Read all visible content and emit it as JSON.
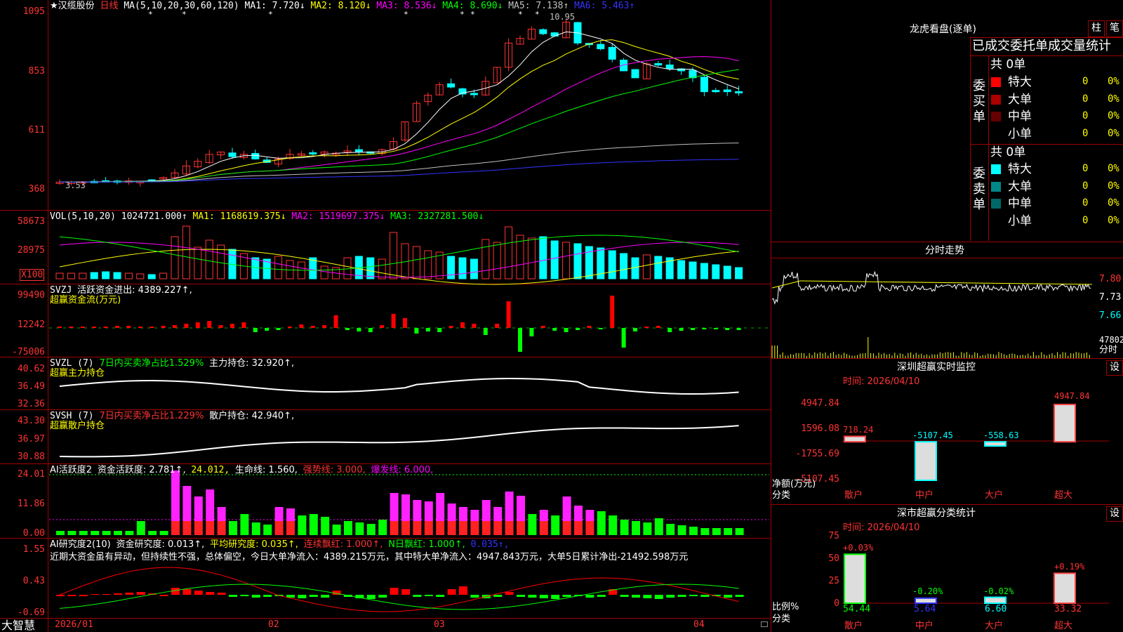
{
  "stock": {
    "star": "★",
    "name": "汉缆股份",
    "period": "日线"
  },
  "ma_header": {
    "params": "MA(5,10,20,30,60,120)",
    "ma1": "MA1: 7.720↓",
    "ma2": "MA2: 8.120↓",
    "ma3": "MA3: 8.536↓",
    "ma4": "MA4: 8.690↓",
    "ma5": "MA5: 7.138↑",
    "ma6": "MA6: 5.463↑",
    "high_mark": "10.95",
    "low_mark": "3.53"
  },
  "price_axis": [
    "1095",
    "853",
    "611",
    "368"
  ],
  "vol_header": {
    "params": "VOL(5,10,20)",
    "vol": "1024721.000↑",
    "ma1": "MA1: 1168619.375↓",
    "ma2": "MA2: 1519697.375↓",
    "ma3": "MA3: 2327281.500↓"
  },
  "vol_axis": [
    "58673",
    "28975",
    "X100"
  ],
  "svzj": {
    "name": "SVZJ",
    "label": "活跃资金进出: 4389.227↑,",
    "sub": "超赢资金流(万元)",
    "axis": [
      "99490",
      "12242",
      "-75006"
    ]
  },
  "svzl": {
    "name": "SVZL (7)",
    "ratio": "7日内买卖净占比1.529%",
    "label": "主力持仓: 32.920↑,",
    "sub": "超赢主力持仓",
    "axis": [
      "40.62",
      "36.49",
      "32.36"
    ]
  },
  "svsh": {
    "name": "SVSH (7)",
    "ratio": "7日内买卖净占比1.229%",
    "label": "散户持仓: 42.940↑,",
    "sub": "超赢散户持仓",
    "axis": [
      "43.30",
      "36.97",
      "30.88"
    ]
  },
  "ai1": {
    "name": "AI活跃度2",
    "l1": "资金活跃度: 2.781↑,",
    "l2": "24.012,",
    "l3": "生命线: 1.560,",
    "l4": "强势线: 3.000,",
    "l5": "爆发线: 6.000,",
    "axis": [
      "24.01",
      "11.86",
      "0.00"
    ]
  },
  "ai2": {
    "name": "AI研究度2(10)",
    "l1": "资金研究度: 0.013↑,",
    "l2": "平均研究度: 0.035↑,",
    "l3": "连续飘红: 1.000↑,",
    "l4": "N日飘红: 1.000↑,",
    "l5": "0.035↑,",
    "note": "近期大资金虽有异动，但持续性不强，总体偏空，今日大单净流入：4389.215万元，其中特大单净流入：4947.843万元，大单5日累计净出-21492.598万元",
    "axis": [
      "1.55",
      "0.43",
      "-0.69"
    ]
  },
  "date_axis": {
    "logo": "大智慧",
    "d1": "2026/01",
    "d2": "02",
    "d3": "03",
    "d4": "04"
  },
  "dragon": {
    "title": "龙虎看盘(逐单)",
    "btn1": "柱",
    "btn2": "笔",
    "header": "已成交委托单成交量统计",
    "buy_label": "委买单",
    "sell_label": "委卖单",
    "buy_total": "共 0单",
    "sell_total": "共 0单",
    "buy_rows": [
      {
        "label": "特大",
        "count": "0",
        "pct": "0%",
        "color": "#ff0000"
      },
      {
        "label": "大单",
        "count": "0",
        "pct": "0%",
        "color": "#aa0000"
      },
      {
        "label": "中单",
        "count": "0",
        "pct": "0%",
        "color": "#660000"
      },
      {
        "label": "小单",
        "count": "0",
        "pct": "0%",
        "color": ""
      }
    ],
    "sell_rows": [
      {
        "label": "特大",
        "count": "0",
        "pct": "0%",
        "color": "#00ffff"
      },
      {
        "label": "大单",
        "count": "0",
        "pct": "0%",
        "color": "#008888"
      },
      {
        "label": "中单",
        "count": "0",
        "pct": "0%",
        "color": "#006666"
      },
      {
        "label": "小单",
        "count": "0",
        "pct": "0%",
        "color": ""
      }
    ]
  },
  "intraday": {
    "title": "分时走势",
    "axis": [
      "7.80",
      "7.73",
      "7.66"
    ],
    "vol": "47802",
    "vol_label": "分时"
  },
  "sz_monitor": {
    "title": "深圳超赢实时监控",
    "btn": "设",
    "time": "时间: 2026/04/10",
    "axis": [
      "4947.84",
      "1596.08",
      "-1755.69",
      "-5107.45"
    ],
    "ylabel": "净额(万元)",
    "xlabel": "分类",
    "categories": [
      "散户",
      "中户",
      "大户",
      "超大"
    ],
    "values": [
      "718.24",
      "-5107.45",
      "-558.63",
      "4947.84"
    ]
  },
  "sz_class": {
    "title": "深市超赢分类统计",
    "btn": "设",
    "time": "时间: 2026/04/10",
    "axis": [
      "75",
      "50",
      "25",
      "0"
    ],
    "ylabel": "比例%",
    "xlabel": "分类",
    "categories": [
      "散户",
      "中户",
      "大户",
      "超大"
    ],
    "changes": [
      "+0.03%",
      "-0.20%",
      "-0.02%",
      "+0.19%"
    ],
    "values": [
      "54.44",
      "5.64",
      "6.60",
      "33.32"
    ]
  },
  "chart_data": [
    {
      "type": "bar",
      "title": "深圳超赢实时监控",
      "ylabel": "净额(万元)",
      "xlabel": "分类",
      "categories": [
        "散户",
        "中户",
        "大户",
        "超大"
      ],
      "values": [
        718.24,
        -5107.45,
        -558.63,
        4947.84
      ],
      "ylim": [
        -5107.45,
        4947.84
      ]
    },
    {
      "type": "bar",
      "title": "深市超赢分类统计",
      "ylabel": "比例%",
      "xlabel": "分类",
      "categories": [
        "散户",
        "中户",
        "大户",
        "超大"
      ],
      "values": [
        54.44,
        5.64,
        6.6,
        33.32
      ],
      "ylim": [
        0,
        75
      ]
    }
  ]
}
